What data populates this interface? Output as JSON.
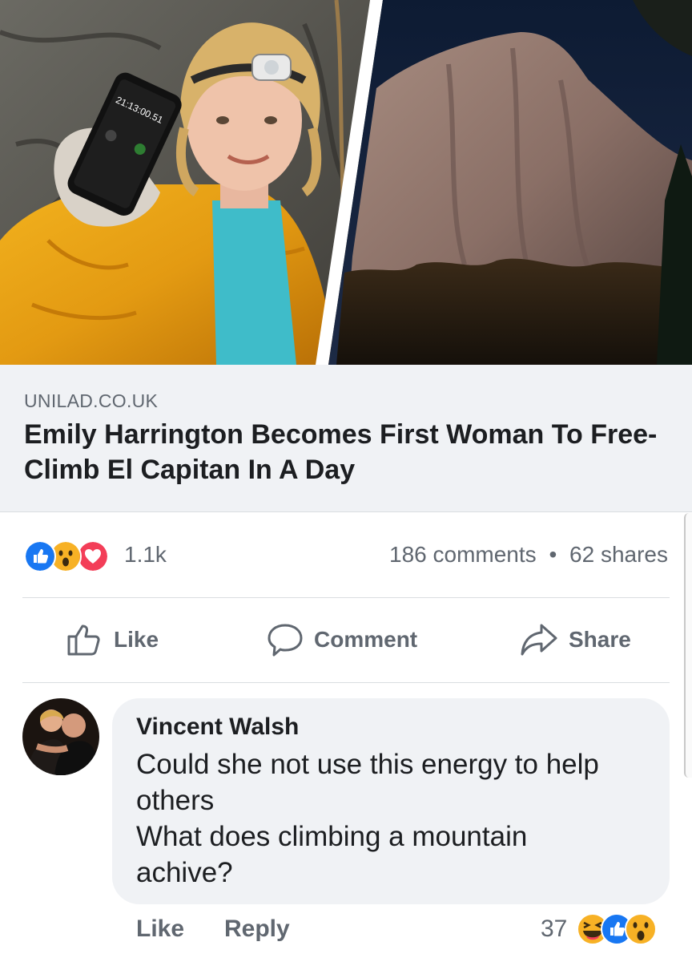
{
  "post": {
    "link_preview": {
      "domain": "UNILAD.CO.UK",
      "headline": "Emily Harrington Becomes First Woman To Free-Climb El Capitan In A Day",
      "phone_time": "21:13:00.51"
    },
    "reactions": {
      "types": [
        "like-icon",
        "wow-icon",
        "love-icon"
      ],
      "count": "1.1k",
      "comments": "186 comments",
      "shares": "62 shares",
      "separator": "•"
    },
    "actions": {
      "like": "Like",
      "comment": "Comment",
      "share": "Share"
    }
  },
  "comment": {
    "author": "Vincent Walsh",
    "lines": [
      "Could she not use this energy to help",
      "others",
      "What does climbing a mountain",
      "achive?"
    ],
    "like_label": "Like",
    "reply_label": "Reply",
    "reaction_count": "37",
    "reaction_types": [
      "haha-icon",
      "like-icon",
      "wow-icon"
    ]
  },
  "colors": {
    "text_primary": "#1c1e21",
    "text_secondary": "#606770",
    "bubble_bg": "#f0f2f5",
    "like_blue": "#1877f2",
    "love_red": "#f33e58",
    "emoji_yellow": "#f7b125"
  }
}
